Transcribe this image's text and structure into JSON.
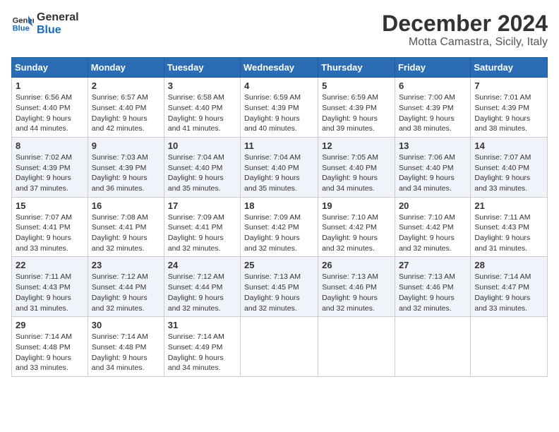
{
  "logo": {
    "line1": "General",
    "line2": "Blue"
  },
  "title": "December 2024",
  "location": "Motta Camastra, Sicily, Italy",
  "days_of_week": [
    "Sunday",
    "Monday",
    "Tuesday",
    "Wednesday",
    "Thursday",
    "Friday",
    "Saturday"
  ],
  "weeks": [
    [
      {
        "day": "1",
        "sunrise": "6:56 AM",
        "sunset": "4:40 PM",
        "daylight": "9 hours and 44 minutes."
      },
      {
        "day": "2",
        "sunrise": "6:57 AM",
        "sunset": "4:40 PM",
        "daylight": "9 hours and 42 minutes."
      },
      {
        "day": "3",
        "sunrise": "6:58 AM",
        "sunset": "4:40 PM",
        "daylight": "9 hours and 41 minutes."
      },
      {
        "day": "4",
        "sunrise": "6:59 AM",
        "sunset": "4:39 PM",
        "daylight": "9 hours and 40 minutes."
      },
      {
        "day": "5",
        "sunrise": "6:59 AM",
        "sunset": "4:39 PM",
        "daylight": "9 hours and 39 minutes."
      },
      {
        "day": "6",
        "sunrise": "7:00 AM",
        "sunset": "4:39 PM",
        "daylight": "9 hours and 38 minutes."
      },
      {
        "day": "7",
        "sunrise": "7:01 AM",
        "sunset": "4:39 PM",
        "daylight": "9 hours and 38 minutes."
      }
    ],
    [
      {
        "day": "8",
        "sunrise": "7:02 AM",
        "sunset": "4:39 PM",
        "daylight": "9 hours and 37 minutes."
      },
      {
        "day": "9",
        "sunrise": "7:03 AM",
        "sunset": "4:39 PM",
        "daylight": "9 hours and 36 minutes."
      },
      {
        "day": "10",
        "sunrise": "7:04 AM",
        "sunset": "4:40 PM",
        "daylight": "9 hours and 35 minutes."
      },
      {
        "day": "11",
        "sunrise": "7:04 AM",
        "sunset": "4:40 PM",
        "daylight": "9 hours and 35 minutes."
      },
      {
        "day": "12",
        "sunrise": "7:05 AM",
        "sunset": "4:40 PM",
        "daylight": "9 hours and 34 minutes."
      },
      {
        "day": "13",
        "sunrise": "7:06 AM",
        "sunset": "4:40 PM",
        "daylight": "9 hours and 34 minutes."
      },
      {
        "day": "14",
        "sunrise": "7:07 AM",
        "sunset": "4:40 PM",
        "daylight": "9 hours and 33 minutes."
      }
    ],
    [
      {
        "day": "15",
        "sunrise": "7:07 AM",
        "sunset": "4:41 PM",
        "daylight": "9 hours and 33 minutes."
      },
      {
        "day": "16",
        "sunrise": "7:08 AM",
        "sunset": "4:41 PM",
        "daylight": "9 hours and 32 minutes."
      },
      {
        "day": "17",
        "sunrise": "7:09 AM",
        "sunset": "4:41 PM",
        "daylight": "9 hours and 32 minutes."
      },
      {
        "day": "18",
        "sunrise": "7:09 AM",
        "sunset": "4:42 PM",
        "daylight": "9 hours and 32 minutes."
      },
      {
        "day": "19",
        "sunrise": "7:10 AM",
        "sunset": "4:42 PM",
        "daylight": "9 hours and 32 minutes."
      },
      {
        "day": "20",
        "sunrise": "7:10 AM",
        "sunset": "4:42 PM",
        "daylight": "9 hours and 32 minutes."
      },
      {
        "day": "21",
        "sunrise": "7:11 AM",
        "sunset": "4:43 PM",
        "daylight": "9 hours and 31 minutes."
      }
    ],
    [
      {
        "day": "22",
        "sunrise": "7:11 AM",
        "sunset": "4:43 PM",
        "daylight": "9 hours and 31 minutes."
      },
      {
        "day": "23",
        "sunrise": "7:12 AM",
        "sunset": "4:44 PM",
        "daylight": "9 hours and 32 minutes."
      },
      {
        "day": "24",
        "sunrise": "7:12 AM",
        "sunset": "4:44 PM",
        "daylight": "9 hours and 32 minutes."
      },
      {
        "day": "25",
        "sunrise": "7:13 AM",
        "sunset": "4:45 PM",
        "daylight": "9 hours and 32 minutes."
      },
      {
        "day": "26",
        "sunrise": "7:13 AM",
        "sunset": "4:46 PM",
        "daylight": "9 hours and 32 minutes."
      },
      {
        "day": "27",
        "sunrise": "7:13 AM",
        "sunset": "4:46 PM",
        "daylight": "9 hours and 32 minutes."
      },
      {
        "day": "28",
        "sunrise": "7:14 AM",
        "sunset": "4:47 PM",
        "daylight": "9 hours and 33 minutes."
      }
    ],
    [
      {
        "day": "29",
        "sunrise": "7:14 AM",
        "sunset": "4:48 PM",
        "daylight": "9 hours and 33 minutes."
      },
      {
        "day": "30",
        "sunrise": "7:14 AM",
        "sunset": "4:48 PM",
        "daylight": "9 hours and 34 minutes."
      },
      {
        "day": "31",
        "sunrise": "7:14 AM",
        "sunset": "4:49 PM",
        "daylight": "9 hours and 34 minutes."
      },
      null,
      null,
      null,
      null
    ]
  ]
}
